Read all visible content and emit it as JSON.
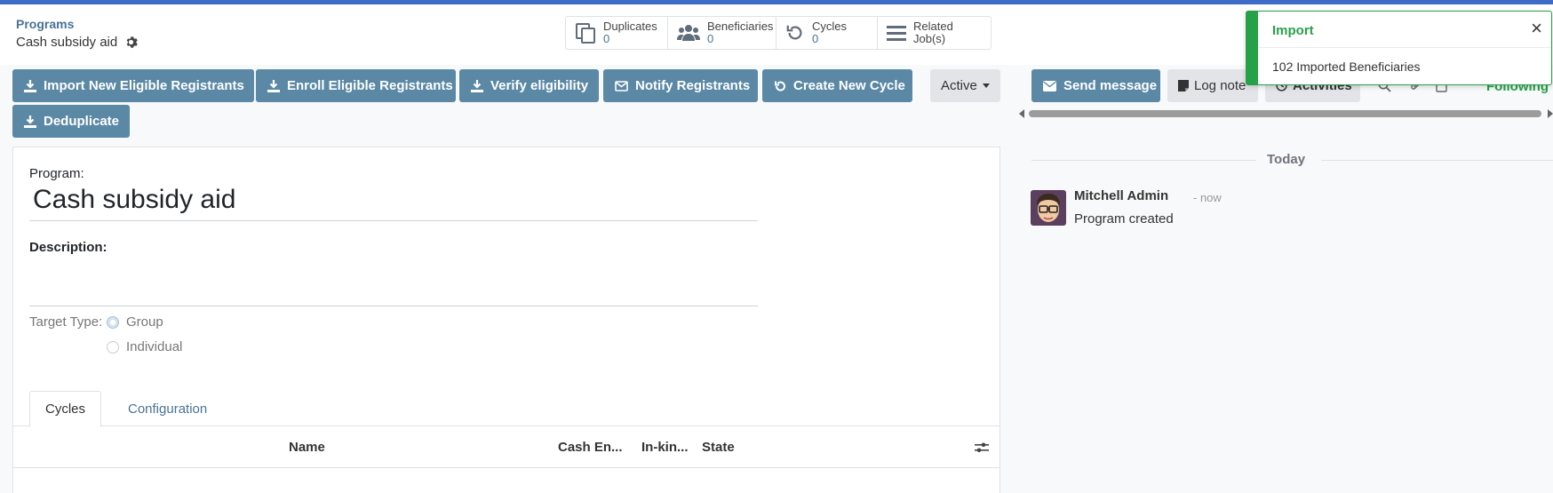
{
  "breadcrumb": {
    "parent": "Programs",
    "current": "Cash subsidy aid"
  },
  "smart_buttons": [
    {
      "label": "Duplicates",
      "value": "0",
      "icon": "duplicates-icon"
    },
    {
      "label": "Beneficiaries",
      "value": "0",
      "icon": "users-icon"
    },
    {
      "label": "Cycles",
      "value": "0",
      "icon": "refresh-icon"
    },
    {
      "label": "Related Job(s)",
      "value": "",
      "icon": "list-icon"
    }
  ],
  "actions": {
    "import": "Import New Eligible Registrants",
    "enroll": "Enroll Eligible Registrants",
    "verify": "Verify eligibility",
    "notify": "Notify Registrants",
    "create_cycle": "Create New Cycle",
    "deduplicate": "Deduplicate",
    "status": "Active"
  },
  "form": {
    "program_label": "Program:",
    "program_name": "Cash subsidy aid",
    "description_label": "Description:",
    "target_type_label": "Target Type:",
    "target_options": [
      "Group",
      "Individual"
    ],
    "target_selected": "Group"
  },
  "tabs": [
    {
      "label": "Cycles",
      "active": true
    },
    {
      "label": "Configuration",
      "active": false
    }
  ],
  "table": {
    "columns": [
      "Name",
      "Cash En...",
      "In-kin...",
      "State"
    ]
  },
  "chatter": {
    "send_message": "Send message",
    "log_note": "Log note",
    "activities": "Activities",
    "following": "Following",
    "date_separator": "Today",
    "message": {
      "author": "Mitchell Admin",
      "time": "- now",
      "body": "Program created"
    }
  },
  "toast": {
    "title": "Import",
    "close": "×",
    "body": "102 Imported Beneficiaries"
  },
  "colors": {
    "primary": "#5b88a5",
    "link": "#4a7394",
    "success": "#27a148",
    "topbar": "#3d6cc7"
  }
}
